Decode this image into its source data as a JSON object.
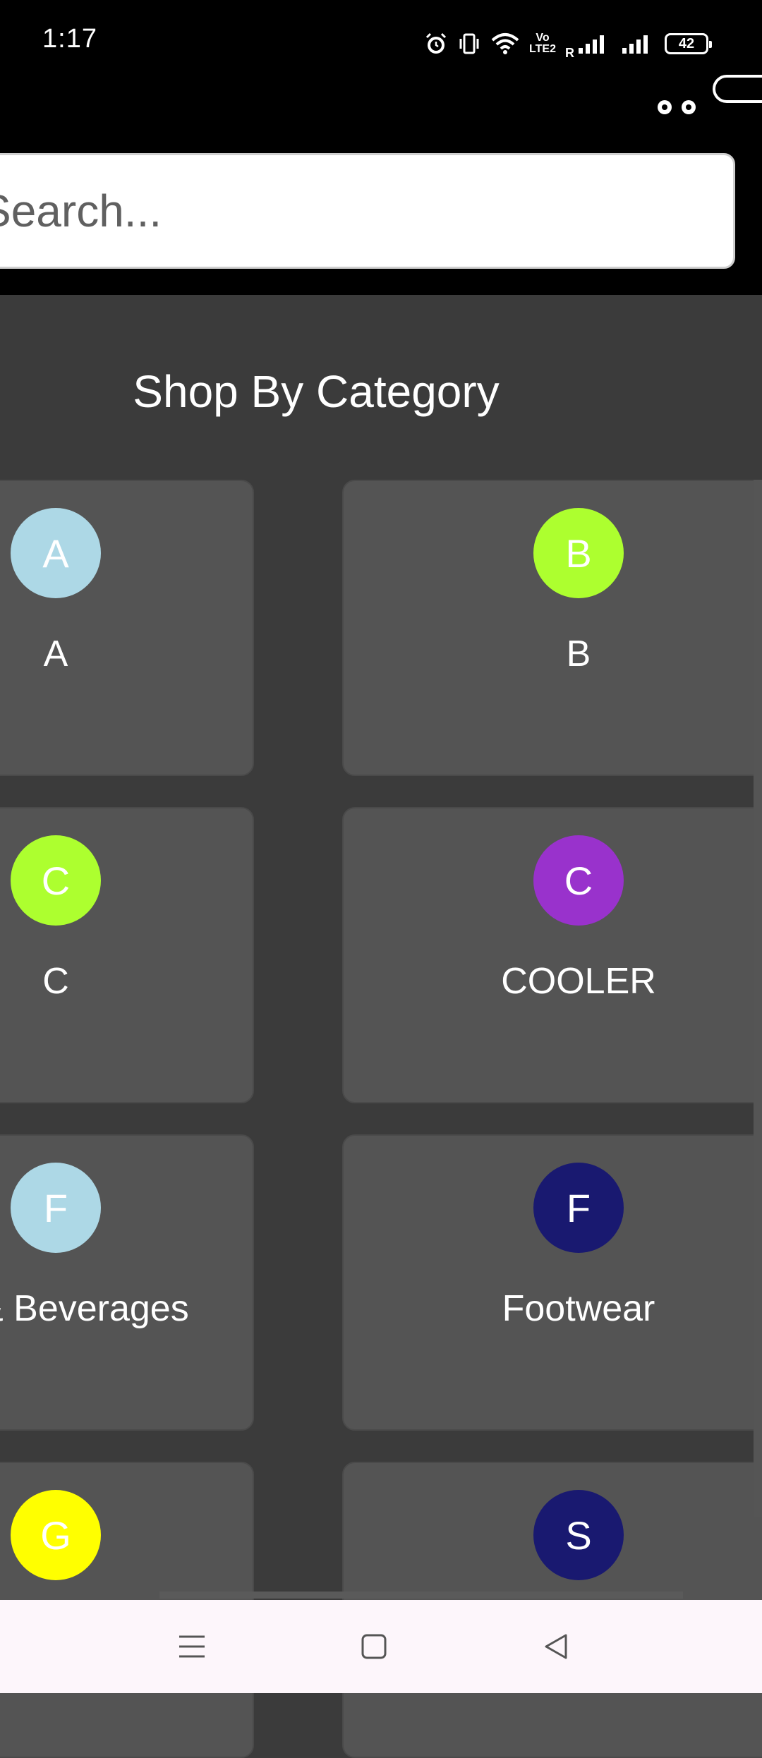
{
  "status_bar": {
    "time": "1:17",
    "volte_label": "Vo LTE2",
    "roaming_label": "R",
    "battery_level": "42"
  },
  "search": {
    "placeholder": "Search..."
  },
  "section_title": "Shop By Category",
  "categories": [
    {
      "initial": "A",
      "label": "A",
      "color": "#add8e6"
    },
    {
      "initial": "B",
      "label": "B",
      "color": "#adff2f"
    },
    {
      "initial": "C",
      "label": "C",
      "color": "#adff2f"
    },
    {
      "initial": "C",
      "label": "COOLER",
      "color": "#9932cc"
    },
    {
      "initial": "F",
      "label": "& Beverages",
      "color": "#add8e6"
    },
    {
      "initial": "F",
      "label": "Footwear",
      "color": "#191970"
    },
    {
      "initial": "G",
      "label": "",
      "color": "#ffff00"
    },
    {
      "initial": "S",
      "label": "",
      "color": "#191970"
    }
  ],
  "nav": {
    "icons": [
      "menu-icon",
      "home-square-icon",
      "back-triangle-icon"
    ]
  }
}
